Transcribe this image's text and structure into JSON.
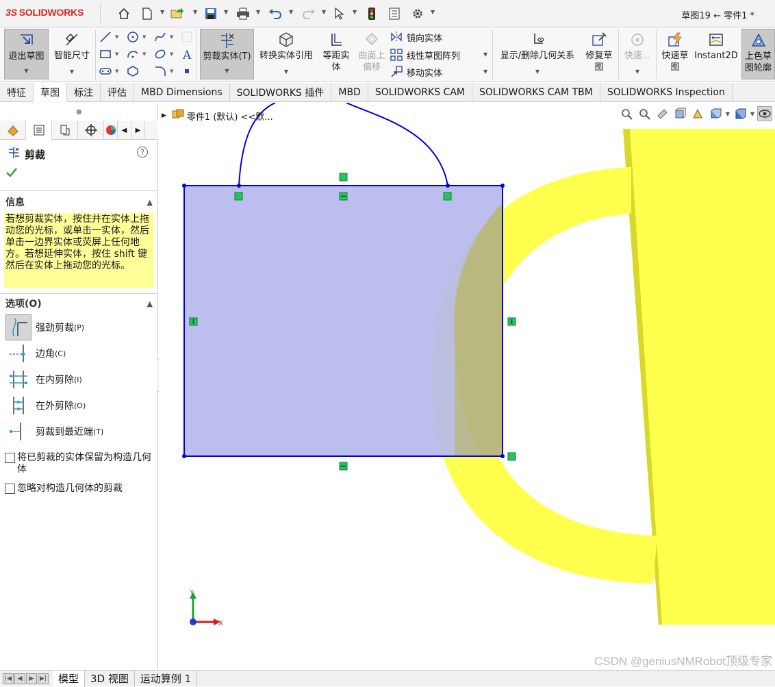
{
  "app": {
    "brand": "SOLIDWORKS",
    "brand_prefix": "3S",
    "document_title": "草图19 ← 零件1 *"
  },
  "toolbar": {
    "exit_sketch": "退出草图",
    "smart_dimension": "智能尺寸",
    "trim_entities": "剪裁实体(T)",
    "convert_entities": "转换实体引用",
    "offset_entities": "等距实体",
    "offset_on_surface": "曲面上偏移",
    "mirror_entities": "镜向实体",
    "linear_pattern": "线性草图阵列",
    "move_entities": "移动实体",
    "display_relations": "显示/删除几何关系",
    "repair_sketch": "修复草图",
    "quick_snaps": "快速...",
    "rapid_sketch": "快速草图",
    "instant2d": "Instant2D",
    "shaded_sketch": "上色草图轮廓"
  },
  "tabs": [
    "特征",
    "草图",
    "标注",
    "评估",
    "MBD Dimensions",
    "SOLIDWORKS 插件",
    "MBD",
    "SOLIDWORKS CAM",
    "SOLIDWORKS CAM TBM",
    "SOLIDWORKS Inspection"
  ],
  "active_tab_index": 1,
  "property_manager": {
    "title": "剪裁",
    "info_heading": "信息",
    "info_text": "若想剪裁实体，按住并在实体上拖动您的光标，或单击一实体，然后单击一边界实体或荧屏上任何地方。若想延伸实体，按住 shift 键然后在实体上拖动您的光标。",
    "options_heading": "选项(O)",
    "options": [
      {
        "label": "强劲剪裁",
        "shortcut": "(P)",
        "selected": true
      },
      {
        "label": "边角",
        "shortcut": "(C)",
        "selected": false
      },
      {
        "label": "在内剪除",
        "shortcut": "(I)",
        "selected": false
      },
      {
        "label": "在外剪除",
        "shortcut": "(O)",
        "selected": false
      },
      {
        "label": "剪裁到最近端",
        "shortcut": "(T)",
        "selected": false
      }
    ],
    "checkbox_keep_construction": "将已剪裁的实体保留为构造几何体",
    "checkbox_ignore_construction": "忽略对构造几何体的剪裁"
  },
  "graphics": {
    "tree_item": "零件1 (默认) <<默...",
    "axis_x": "X",
    "axis_y": "Y",
    "watermark": "CSDN @geniusNMRobot顶级专家",
    "colors": {
      "sketch": "#0000dd",
      "fill": "#b6b8ed",
      "model": "#ffff4d",
      "relation": "#22c55e"
    }
  },
  "bottom_tabs": [
    "模型",
    "3D 视图",
    "运动算例 1"
  ],
  "active_bottom_tab_index": 0
}
